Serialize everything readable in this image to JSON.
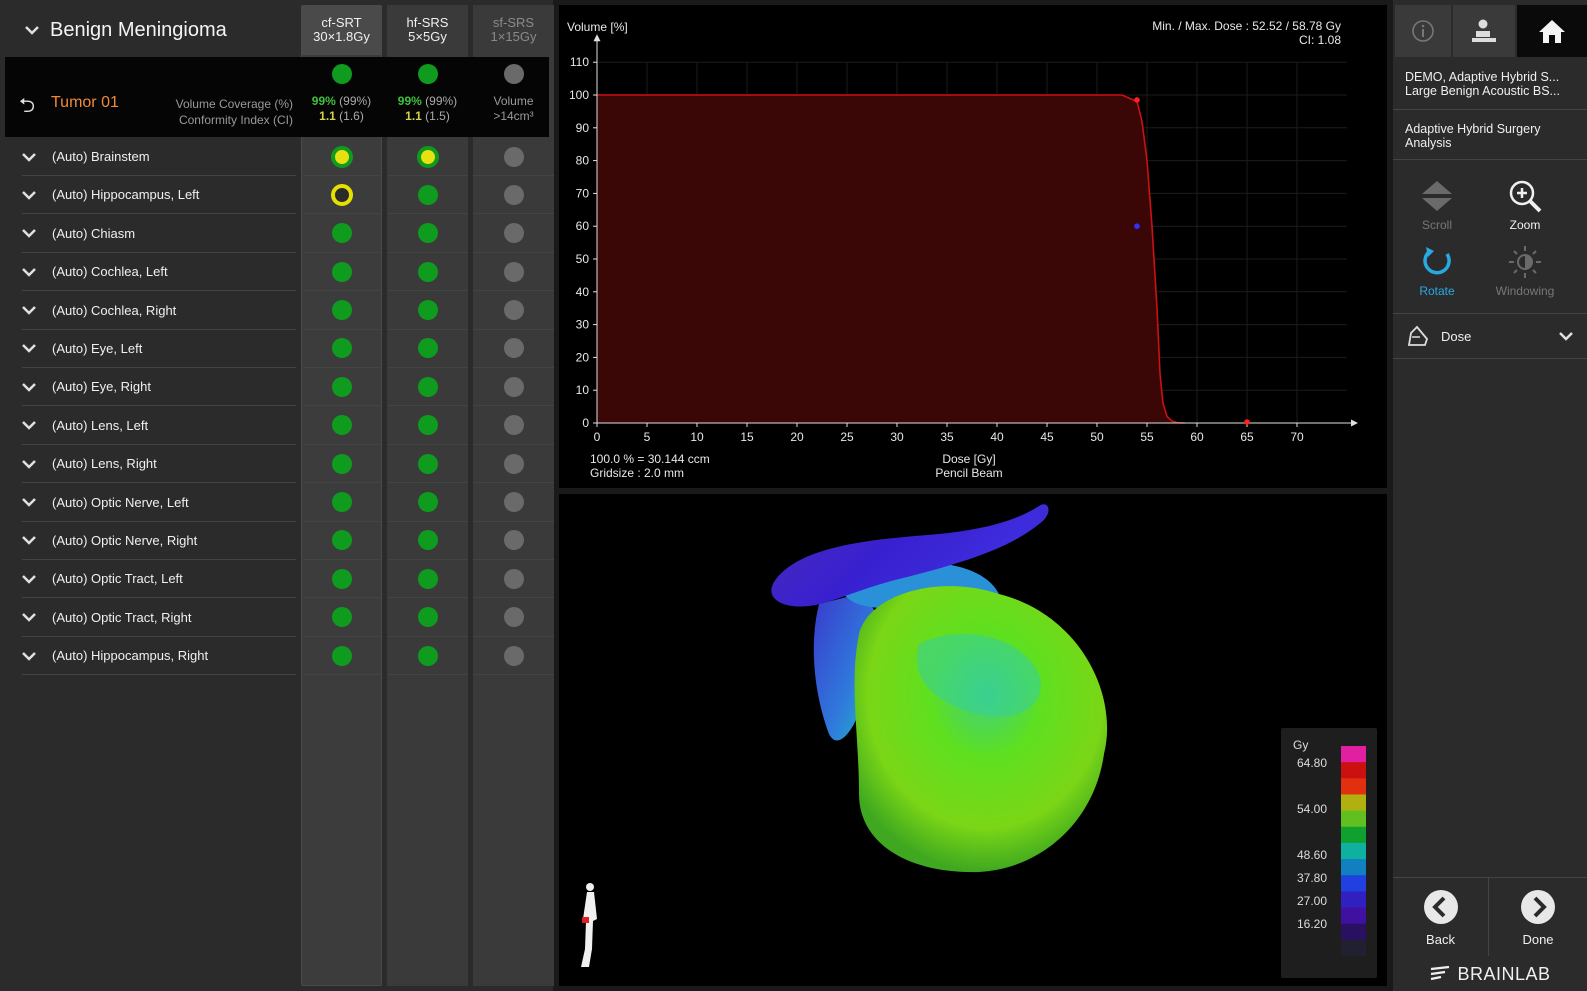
{
  "header": {
    "title": "Benign Meningioma"
  },
  "plans": [
    {
      "name": "cf-SRT",
      "scheme": "30×1.8Gy",
      "enabled": true
    },
    {
      "name": "hf-SRS",
      "scheme": "5×5Gy",
      "enabled": true
    },
    {
      "name": "sf-SRS",
      "scheme": "1×15Gy",
      "enabled": false
    }
  ],
  "tumor": {
    "back_symbol": "⮌",
    "name": "Tumor 01",
    "metric1": "Volume Coverage (%)",
    "metric2": "Conformity Index (CI)",
    "cells": [
      {
        "status": "green",
        "cov": "99%",
        "cov_ref": "(99%)",
        "ci": "1.1",
        "ci_ref": "(1.6)"
      },
      {
        "status": "green",
        "cov": "99%",
        "cov_ref": "(99%)",
        "ci": "1.1",
        "ci_ref": "(1.5)"
      },
      {
        "status": "grey",
        "text1": "Volume",
        "text2": ">14cm³"
      }
    ]
  },
  "organs": [
    {
      "name": "(Auto) Brainstem",
      "status": [
        "yellow-fill",
        "yellow-fill",
        "grey"
      ]
    },
    {
      "name": "(Auto) Hippocampus, Left",
      "status": [
        "yellow-ring",
        "green",
        "grey"
      ]
    },
    {
      "name": "(Auto) Chiasm",
      "status": [
        "green",
        "green",
        "grey"
      ]
    },
    {
      "name": "(Auto) Cochlea, Left",
      "status": [
        "green",
        "green",
        "grey"
      ]
    },
    {
      "name": "(Auto) Cochlea, Right",
      "status": [
        "green",
        "green",
        "grey"
      ]
    },
    {
      "name": "(Auto) Eye, Left",
      "status": [
        "green",
        "green",
        "grey"
      ]
    },
    {
      "name": "(Auto) Eye, Right",
      "status": [
        "green",
        "green",
        "grey"
      ]
    },
    {
      "name": "(Auto) Lens, Left",
      "status": [
        "green",
        "green",
        "grey"
      ]
    },
    {
      "name": "(Auto) Lens, Right",
      "status": [
        "green",
        "green",
        "grey"
      ]
    },
    {
      "name": "(Auto) Optic Nerve, Left",
      "status": [
        "green",
        "green",
        "grey"
      ]
    },
    {
      "name": "(Auto) Optic Nerve, Right",
      "status": [
        "green",
        "green",
        "grey"
      ]
    },
    {
      "name": "(Auto) Optic Tract, Left",
      "status": [
        "green",
        "green",
        "grey"
      ]
    },
    {
      "name": "(Auto) Optic Tract, Right",
      "status": [
        "green",
        "green",
        "grey"
      ]
    },
    {
      "name": "(Auto) Hippocampus, Right",
      "status": [
        "green",
        "green",
        "grey"
      ]
    }
  ],
  "dvh": {
    "minmax": "Min. / Max. Dose : 52.52 / 58.78 Gy",
    "ci": "CI: 1.08",
    "volume_note": "100.0 % = 30.144 ccm",
    "gridsize": "Gridsize : 2.0 mm",
    "algorithm": "Pencil Beam"
  },
  "chart_data": {
    "type": "area",
    "ylabel": "Volume [%]",
    "xlabel": "Dose [Gy]",
    "xlim": [
      0,
      75
    ],
    "ylim": [
      0,
      110
    ],
    "x_ticks": [
      0,
      5,
      10,
      15,
      20,
      25,
      30,
      35,
      40,
      45,
      50,
      55,
      60,
      65,
      70
    ],
    "y_ticks": [
      0,
      10,
      20,
      30,
      40,
      50,
      60,
      70,
      80,
      90,
      100,
      110
    ],
    "grid": true,
    "series": [
      {
        "x": [
          0,
          50,
          52.5,
          54,
          54.5,
          55,
          55.5,
          56,
          56.3,
          56.6,
          57,
          57.5,
          58,
          58.8
        ],
        "values": [
          100,
          100,
          100,
          98,
          92,
          80,
          60,
          35,
          15,
          6,
          2,
          0.6,
          0.1,
          0
        ],
        "color": "#cc1111"
      }
    ],
    "markers": [
      {
        "x": 54.0,
        "y": 98.5,
        "color": "#ff2020"
      },
      {
        "x": 54.0,
        "y": 60,
        "color": "#3030ff"
      },
      {
        "x": 65.0,
        "y": 0.3,
        "color": "#ff2020"
      }
    ]
  },
  "colorbar": {
    "unit": "Gy",
    "ticks": [
      "64.80",
      "54.00",
      "48.60",
      "37.80",
      "27.00",
      "16.20"
    ]
  },
  "right_panel": {
    "patient_line1": "DEMO, Adaptive Hybrid S...",
    "patient_line2": "Large Benign Acoustic BS...",
    "analysis_line1": "Adaptive Hybrid Surgery",
    "analysis_line2": "Analysis",
    "tools": {
      "scroll": "Scroll",
      "zoom": "Zoom",
      "rotate": "Rotate",
      "windowing": "Windowing"
    },
    "dose_label": "Dose",
    "back_label": "Back",
    "done_label": "Done",
    "brand": "BRAINLAB"
  },
  "colors": {
    "accent": "#29a9e1",
    "tumor": "#f08a3a",
    "ok": "#0e9b1e",
    "warn": "#e6e000"
  }
}
